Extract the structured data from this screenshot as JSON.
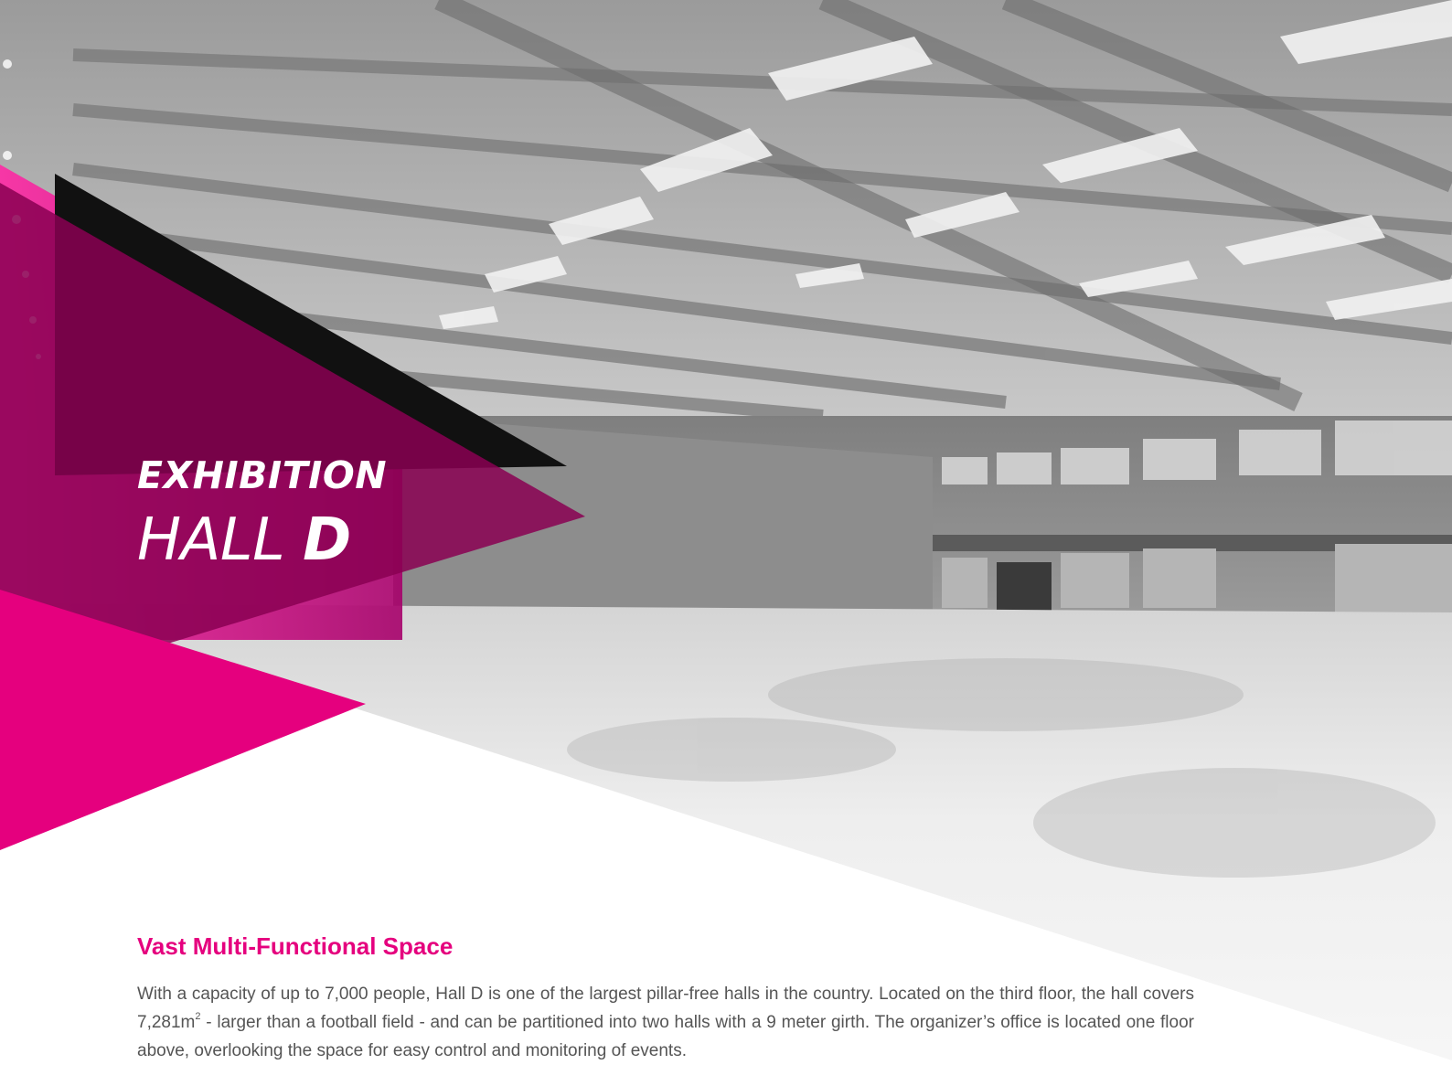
{
  "hero": {
    "title_line1": "EXHIBITION",
    "title_line2_regular": "HALL",
    "title_line2_bold": "D"
  },
  "colors": {
    "accent": "#e5007e",
    "accent_dark": "#8a0052",
    "body_text": "#555555"
  },
  "section": {
    "heading": "Vast Multi-Functional Space",
    "paragraph_before_sup": "With a capacity of up to 7,000 people, Hall D is one of the largest pillar-free halls in the country. Located on the third floor, the hall covers 7,281m",
    "paragraph_sup": "2",
    "paragraph_after_sup": " - larger than a football field - and can be partitioned into two halls with a 9 meter girth. The organizer’s office is located one floor above, overlooking the space for easy control and monitoring of events."
  }
}
